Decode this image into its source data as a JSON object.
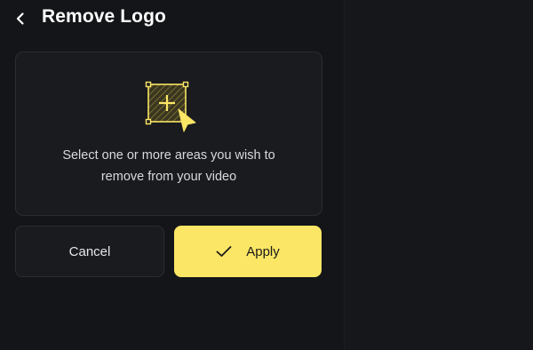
{
  "header": {
    "title": "Remove Logo"
  },
  "select_card": {
    "line1": "Select one or more areas you wish to",
    "line2": "remove from your video",
    "icon": "select-area-icon"
  },
  "actions": {
    "cancel_label": "Cancel",
    "apply_label": "Apply"
  },
  "colors": {
    "accent": "#fbe665",
    "background": "#131418",
    "card": "#1a1b1f",
    "border": "#2b2c31"
  }
}
